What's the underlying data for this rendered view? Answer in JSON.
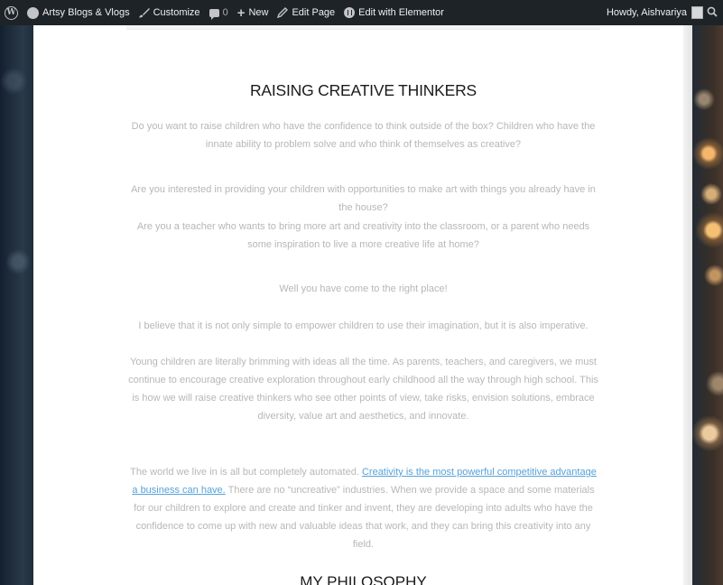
{
  "admin_bar": {
    "site_name": "Artsy Blogs & Vlogs",
    "customize": "Customize",
    "comments_count": "0",
    "new": "New",
    "edit_page": "Edit Page",
    "edit_elementor": "Edit with Elementor",
    "howdy": "Howdy, Aishvariya",
    "icons": [
      "wordpress-logo-icon",
      "site-home-icon",
      "brush-icon",
      "comment-bubble-icon",
      "plus-icon",
      "pencil-icon",
      "elementor-icon",
      "search-icon"
    ]
  },
  "article": {
    "title": "RAISING CREATIVE THINKERS",
    "paragraphs": [
      "Do you want to raise children who have the confidence to think outside of the box? Children who have the innate ability to problem solve and who think of themselves as creative?",
      "Are you interested in providing your children with opportunities to make art with things you already have in the house?",
      "Are you a teacher who wants to bring more art and creativity into the classroom, or a parent who needs some inspiration to live a more creative life at home?",
      "Well you have come to the right place!",
      "I believe that it is not only simple to empower children to use their imagination, but it is also imperative.",
      "Young children are literally brimming with ideas all the time. As parents, teachers, and caregivers, we must continue to encourage creative exploration throughout early childhood all the way through high school. This is how we will raise creative thinkers who see other points of view, take risks, envision solutions, embrace diversity, value art and aesthetics, and innovate."
    ],
    "last_paragraph": {
      "before_link": "The world we live in is all but completely automated. ",
      "link": "Creativity is the most powerful competitive advantage a business can have.",
      "after_link": " There are no “uncreative” industries. When we provide a space and some materials for our children to explore and create and tinker and invent, they are developing into adults who have the confidence to come up with new and valuable ideas that work, and they can bring this creativity into any field."
    },
    "next_heading": "MY PHILOSOPHY"
  },
  "colors": {
    "admin_bar_bg": "#1d2327",
    "body_text": "#b7b7b7",
    "link": "#55a2d8",
    "heading": "#1a1a1a"
  }
}
